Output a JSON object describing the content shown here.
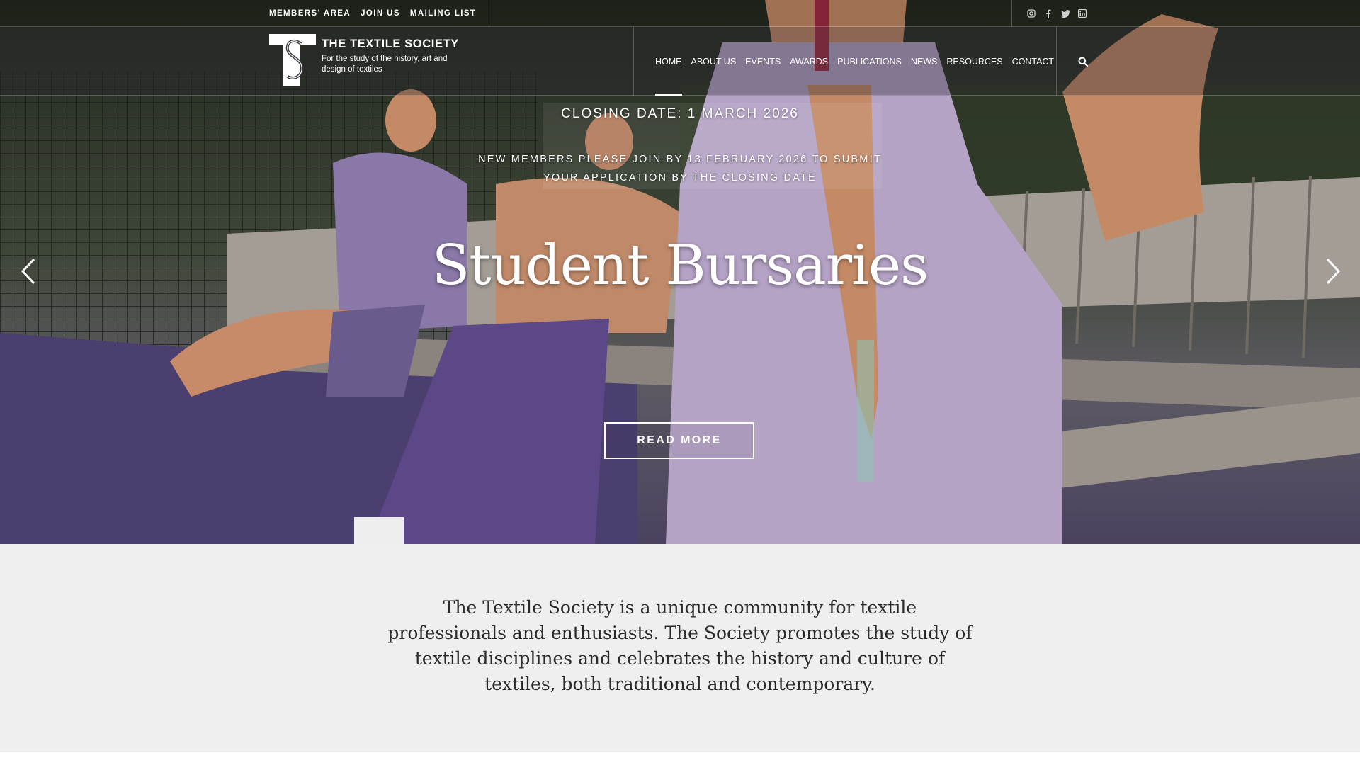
{
  "utility_bar": {
    "links": [
      "MEMBERS' AREA",
      "JOIN US",
      "MAILING LIST"
    ],
    "social_icons": [
      "instagram-icon",
      "facebook-icon",
      "twitter-icon",
      "linkedin-icon"
    ]
  },
  "header": {
    "logo_title": "THE TEXTILE SOCIETY",
    "logo_subtitle": "For the study of the history, art and design of textiles",
    "nav": [
      "HOME",
      "ABOUT US",
      "EVENTS",
      "AWARDS",
      "PUBLICATIONS",
      "NEWS",
      "RESOURCES",
      "CONTACT"
    ],
    "active_nav": "HOME",
    "search_icon": "search-icon"
  },
  "slide": {
    "closing_date": "CLOSING DATE: 1 MARCH 2026",
    "note_line1": "NEW MEMBERS PLEASE JOIN BY 13 FEBRUARY 2026 TO SUBMIT",
    "note_line2": "YOUR APPLICATION BY THE CLOSING DATE",
    "title": "Student Bursaries",
    "button": "READ MORE",
    "prev_icon": "chevron-left-icon",
    "next_icon": "chevron-right-icon"
  },
  "intro": {
    "text": "The Textile Society is a unique community for textile professionals and enthusiasts. The Society promotes the study of textile disciplines and celebrates the history and culture of textiles, both traditional and contemporary."
  }
}
